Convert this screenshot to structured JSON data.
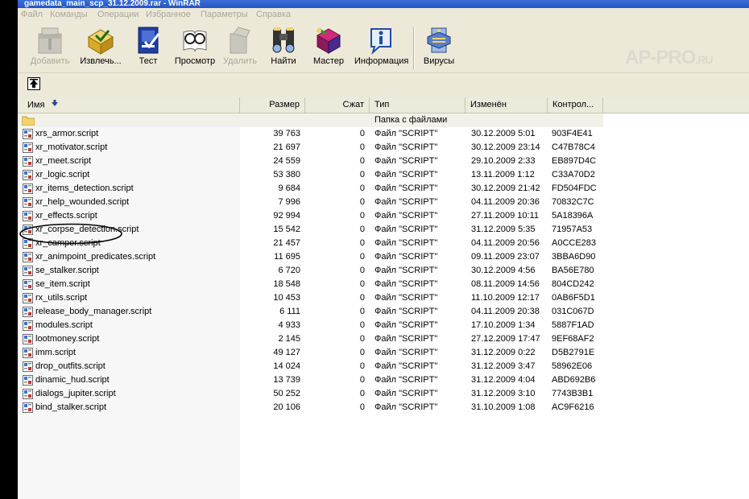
{
  "window": {
    "title": "gamedata_main_scp_31.12.2009.rar - WinRAR"
  },
  "menu": [
    "Файл",
    "Команды",
    "Операции",
    "Избранное",
    "Параметры",
    "Справка"
  ],
  "toolbar": {
    "buttons": [
      {
        "label": "Добавить",
        "icon": "add-archive-icon",
        "enabled": false
      },
      {
        "label": "Извлечь...",
        "icon": "extract-icon",
        "enabled": true
      },
      {
        "label": "Тест",
        "icon": "test-icon",
        "enabled": true
      },
      {
        "label": "Просмотр",
        "icon": "view-icon",
        "enabled": true
      },
      {
        "label": "Удалить",
        "icon": "delete-icon",
        "enabled": false
      },
      {
        "label": "Найти",
        "icon": "find-icon",
        "enabled": true
      },
      {
        "label": "Мастер",
        "icon": "wizard-icon",
        "enabled": true
      },
      {
        "label": "Информация",
        "icon": "info-icon",
        "enabled": true
      },
      {
        "label": "Вирусы",
        "icon": "virus-scan-icon",
        "enabled": true
      }
    ]
  },
  "watermark": {
    "main": "AP-PRO",
    "suffix": ".RU"
  },
  "columns": {
    "name": "Имя",
    "size": "Размер",
    "packed": "Сжат",
    "type": "Тип",
    "modified": "Изменён",
    "crc": "Контрол..."
  },
  "folder_row": {
    "type": "Папка с файлами"
  },
  "files": [
    {
      "name": "xrs_armor.script",
      "size": "39 763",
      "packed": "0",
      "type": "Файл \"SCRIPT\"",
      "modified": "30.12.2009 5:01",
      "crc": "903F4E41"
    },
    {
      "name": "xr_motivator.script",
      "size": "21 697",
      "packed": "0",
      "type": "Файл \"SCRIPT\"",
      "modified": "30.12.2009 23:14",
      "crc": "C47B78C4"
    },
    {
      "name": "xr_meet.script",
      "size": "24 559",
      "packed": "0",
      "type": "Файл \"SCRIPT\"",
      "modified": "29.10.2009 2:33",
      "crc": "EB897D4C"
    },
    {
      "name": "xr_logic.script",
      "size": "53 380",
      "packed": "0",
      "type": "Файл \"SCRIPT\"",
      "modified": "13.11.2009 1:12",
      "crc": "C33A70D2"
    },
    {
      "name": "xr_items_detection.script",
      "size": "9 684",
      "packed": "0",
      "type": "Файл \"SCRIPT\"",
      "modified": "30.12.2009 21:42",
      "crc": "FD504FDC"
    },
    {
      "name": "xr_help_wounded.script",
      "size": "7 996",
      "packed": "0",
      "type": "Файл \"SCRIPT\"",
      "modified": "04.11.2009 20:36",
      "crc": "70832C7C"
    },
    {
      "name": "xr_effects.script",
      "size": "92 994",
      "packed": "0",
      "type": "Файл \"SCRIPT\"",
      "modified": "27.11.2009 10:11",
      "crc": "5A18396A"
    },
    {
      "name": "xr_corpse_detection.script",
      "size": "15 542",
      "packed": "0",
      "type": "Файл \"SCRIPT\"",
      "modified": "31.12.2009 5:35",
      "crc": "71957A53"
    },
    {
      "name": "xr_camper.script",
      "size": "21 457",
      "packed": "0",
      "type": "Файл \"SCRIPT\"",
      "modified": "04.11.2009 20:56",
      "crc": "A0CCE283"
    },
    {
      "name": "xr_animpoint_predicates.script",
      "size": "11 695",
      "packed": "0",
      "type": "Файл \"SCRIPT\"",
      "modified": "09.11.2009 23:07",
      "crc": "3BBA6D90"
    },
    {
      "name": "se_stalker.script",
      "size": "6 720",
      "packed": "0",
      "type": "Файл \"SCRIPT\"",
      "modified": "30.12.2009 4:56",
      "crc": "BA56E780"
    },
    {
      "name": "se_item.script",
      "size": "18 548",
      "packed": "0",
      "type": "Файл \"SCRIPT\"",
      "modified": "08.11.2009 14:56",
      "crc": "804CD242"
    },
    {
      "name": "rx_utils.script",
      "size": "10 453",
      "packed": "0",
      "type": "Файл \"SCRIPT\"",
      "modified": "11.10.2009 12:17",
      "crc": "0AB6F5D1"
    },
    {
      "name": "release_body_manager.script",
      "size": "6 111",
      "packed": "0",
      "type": "Файл \"SCRIPT\"",
      "modified": "04.11.2009 20:38",
      "crc": "031C067D"
    },
    {
      "name": "modules.script",
      "size": "4 933",
      "packed": "0",
      "type": "Файл \"SCRIPT\"",
      "modified": "17.10.2009 1:34",
      "crc": "5887F1AD"
    },
    {
      "name": "lootmoney.script",
      "size": "2 145",
      "packed": "0",
      "type": "Файл \"SCRIPT\"",
      "modified": "27.12.2009 17:47",
      "crc": "9EF68AF2"
    },
    {
      "name": "imm.script",
      "size": "49 127",
      "packed": "0",
      "type": "Файл \"SCRIPT\"",
      "modified": "31.12.2009 0:22",
      "crc": "D5B2791E"
    },
    {
      "name": "drop_outfits.script",
      "size": "14 024",
      "packed": "0",
      "type": "Файл \"SCRIPT\"",
      "modified": "31.12.2009 3:47",
      "crc": "58962E06"
    },
    {
      "name": "dinamic_hud.script",
      "size": "13 739",
      "packed": "0",
      "type": "Файл \"SCRIPT\"",
      "modified": "31.12.2009 4:04",
      "crc": "ABD692B6"
    },
    {
      "name": "dialogs_jupiter.script",
      "size": "50 252",
      "packed": "0",
      "type": "Файл \"SCRIPT\"",
      "modified": "31.12.2009 3:10",
      "crc": "7743B3B1"
    },
    {
      "name": "bind_stalker.script",
      "size": "20 106",
      "packed": "0",
      "type": "Файл \"SCRIPT\"",
      "modified": "31.10.2009 1:08",
      "crc": "AC9F6216"
    }
  ]
}
